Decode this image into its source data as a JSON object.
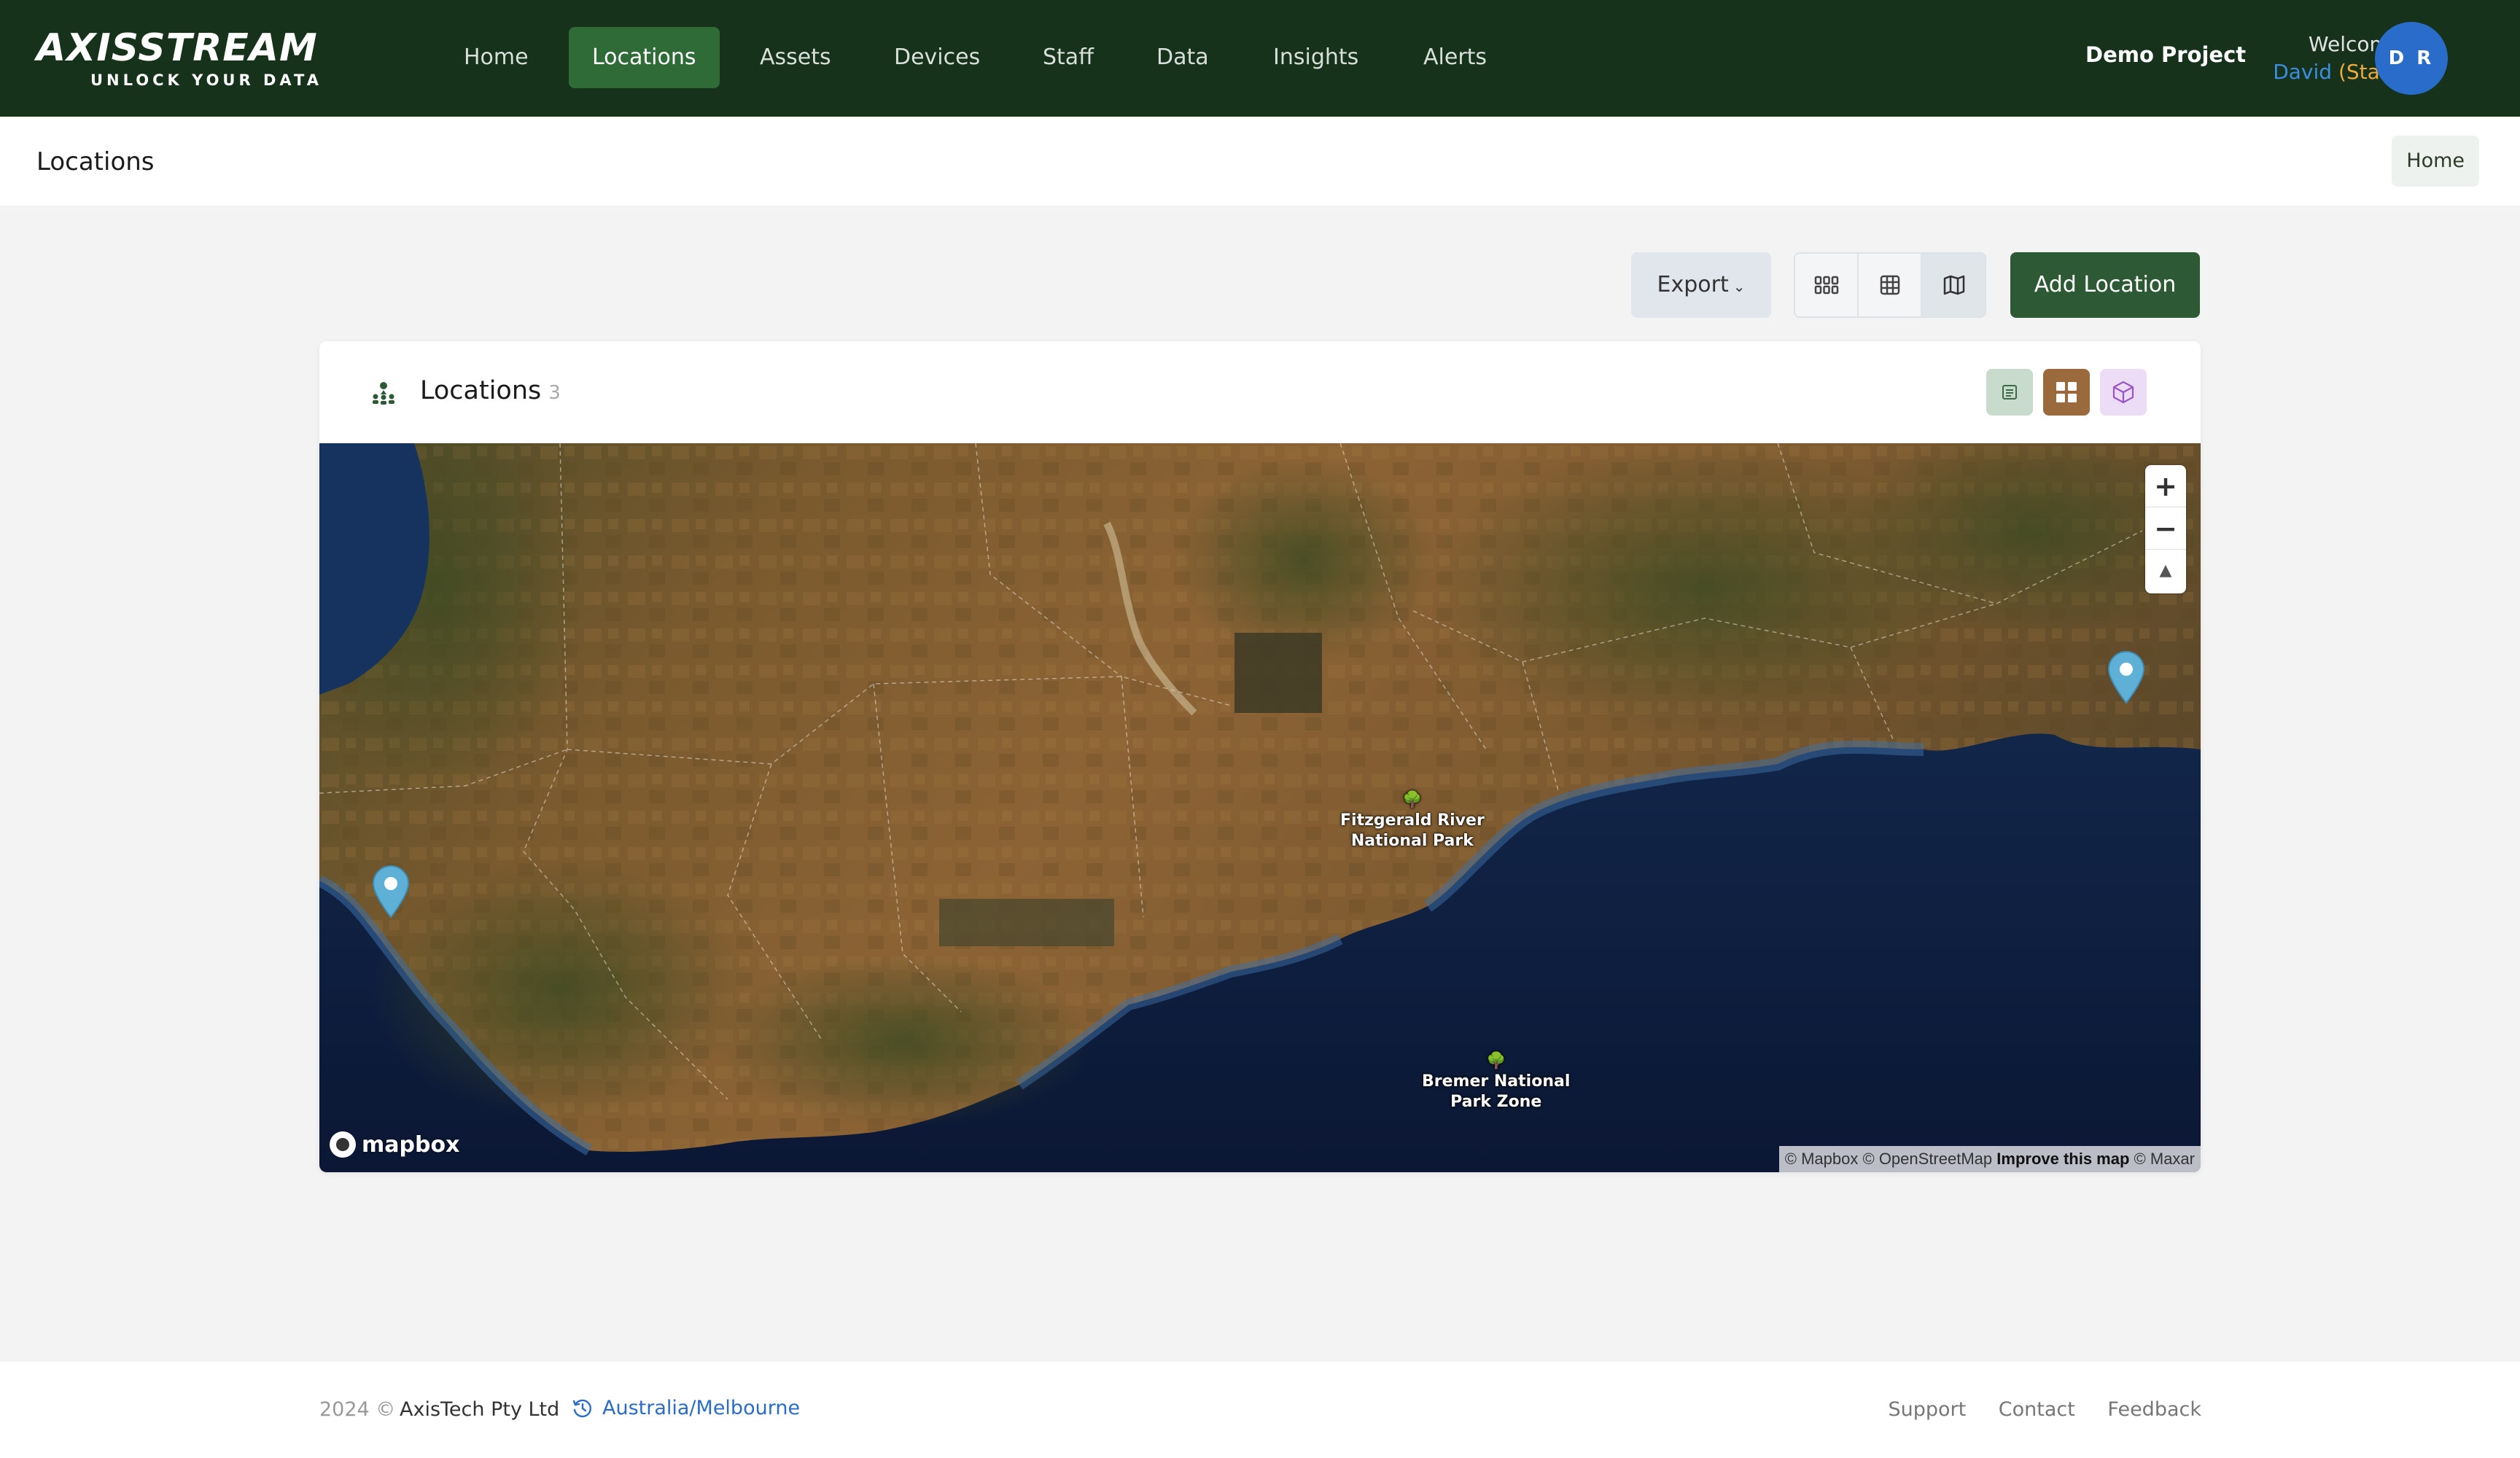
{
  "brand": {
    "name": "AXISSTREAM",
    "tagline": "UNLOCK YOUR DATA"
  },
  "nav": {
    "items": [
      {
        "label": "Home"
      },
      {
        "label": "Locations",
        "active": true
      },
      {
        "label": "Assets"
      },
      {
        "label": "Devices"
      },
      {
        "label": "Staff"
      },
      {
        "label": "Data"
      },
      {
        "label": "Insights"
      },
      {
        "label": "Alerts"
      }
    ]
  },
  "user": {
    "project": "Demo Project",
    "welcome": "Welcome",
    "name": "David",
    "role": "(Staff)",
    "initials": "D R"
  },
  "page": {
    "title": "Locations",
    "breadcrumb": "Home"
  },
  "toolbar": {
    "export_label": "Export",
    "view_modes": [
      "grid-dots-icon",
      "table-icon",
      "map-icon"
    ],
    "add_label": "Add Location"
  },
  "card": {
    "title": "Locations",
    "count": "3",
    "icon": "location-people-icon",
    "modes": [
      "list-icon",
      "grid-icon",
      "cube-icon"
    ]
  },
  "map": {
    "controls": {
      "zoom_in": "+",
      "zoom_out": "−",
      "compass": "▲"
    },
    "pois": [
      {
        "line1": "Fitzgerald River",
        "line2": "National Park"
      },
      {
        "line1": "Bremer National",
        "line2": "Park Zone"
      }
    ],
    "marker_color": "#5fb0d6",
    "logo": "mapbox",
    "attribution": {
      "mapbox": "© Mapbox",
      "osm": "© OpenStreetMap",
      "improve": "Improve this map",
      "maxar": "© Maxar"
    }
  },
  "footer": {
    "year": "2024 ©",
    "company": "AxisTech Pty Ltd",
    "timezone": "Australia/Melbourne",
    "links": [
      "Support",
      "Contact",
      "Feedback"
    ]
  },
  "colors": {
    "nav_bg": "#16321a",
    "nav_active": "#2e6b36",
    "primary_button": "#2d5a35",
    "avatar": "#2a6cc9",
    "link": "#2a6cc9"
  }
}
